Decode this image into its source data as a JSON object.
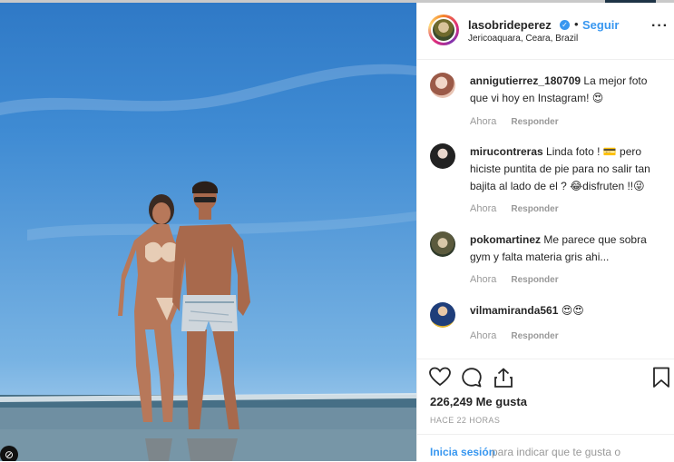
{
  "post": {
    "username": "lasobrideperez",
    "verified_mark": "✓",
    "separator": "•",
    "follow_label": "Seguir",
    "location": "Jericoaquara, Ceara, Brazil",
    "more_label": "···"
  },
  "comments": [
    {
      "user": "annigutierrez_180709",
      "text": "La mejor foto que vi hoy en Instagram! 😍",
      "time": "Ahora",
      "reply": "Responder"
    },
    {
      "user": "mirucontreras",
      "text": "Linda foto ! 💳 pero hiciste puntita de pie para no salir tan bajita al lado de el ? 😂disfruten !!😜",
      "time": "Ahora",
      "reply": "Responder"
    },
    {
      "user": "pokomartinez",
      "text": "Me parece que sobra gym y falta materia gris ahi...",
      "time": "Ahora",
      "reply": "Responder"
    },
    {
      "user": "vilmamiranda561",
      "text": "😍😍",
      "time": "Ahora",
      "reply": "Responder"
    }
  ],
  "icons": {
    "like": "heart-icon",
    "comment": "comment-icon",
    "share": "share-icon",
    "save": "bookmark-icon",
    "more": "more-options-icon",
    "verified": "verified-badge-icon"
  },
  "likes_text": "226,249 Me gusta",
  "time_ago": "HACE 22 HORAS",
  "login": {
    "link": "Inicia sesión",
    "rest": "para indicar que te gusta o"
  },
  "corner_badge": "⊘",
  "colors": {
    "link_blue": "#3897f0",
    "text": "#262626",
    "muted": "#999999"
  }
}
